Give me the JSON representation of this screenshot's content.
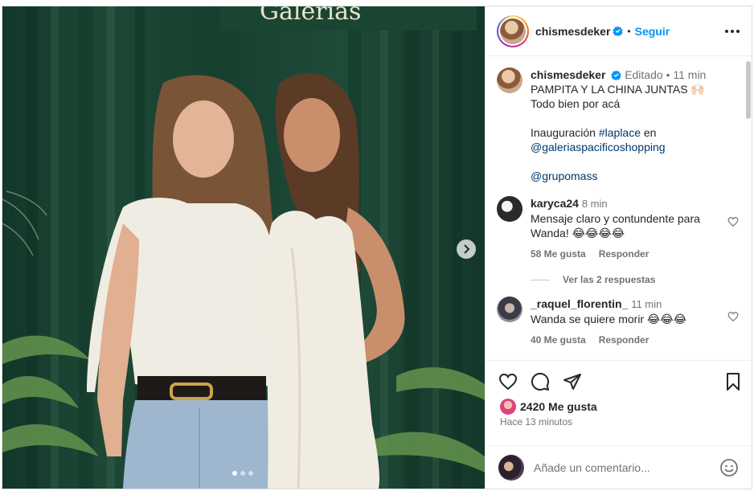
{
  "post": {
    "image_alt": "Dos mujeres posando frente a una cortina verde",
    "carousel": {
      "total": 3,
      "active": 1
    },
    "background_sign": "Galerías"
  },
  "header": {
    "username": "chismesdeker",
    "verified": true,
    "separator": "•",
    "follow_label": "Seguir"
  },
  "caption": {
    "username": "chismesdeker",
    "edited_label": "Editado",
    "separator": "•",
    "time": "11 min",
    "line1": "PAMPITA Y LA CHINA JUNTAS 🙌🏻",
    "line2": "Todo bien por acá",
    "line3_prefix": "Inauguración ",
    "hashtag": "#laplace",
    "line3_suffix": " en",
    "mention1": "@galeriaspacificoshopping",
    "mention2": "@grupomass"
  },
  "comments": [
    {
      "username": "karyca24",
      "time": "8 min",
      "text": "Mensaje claro y contundente para Wanda! 😂😂😂😂",
      "likes": "58 Me gusta",
      "reply_label": "Responder"
    },
    {
      "username": "_raquel_florentin_",
      "time": "11 min",
      "text": "Wanda se quiere morir 😂😂😂",
      "likes": "40 Me gusta",
      "reply_label": "Responder"
    }
  ],
  "view_replies": "Ver las 2 respuestas",
  "likes": {
    "text": "2420 Me gusta"
  },
  "posted_time": "Hace 13 minutos",
  "add_comment": {
    "placeholder": "Añade un comentario..."
  },
  "icons": [
    "heart-icon",
    "comment-icon",
    "share-icon",
    "bookmark-icon",
    "more-options-icon",
    "verified-badge-icon",
    "emoji-icon",
    "chevron-right-icon"
  ],
  "colors": {
    "link": "#00376b",
    "follow": "#0095f6",
    "verified": "#0095f6",
    "curtain": "#1d4836"
  }
}
